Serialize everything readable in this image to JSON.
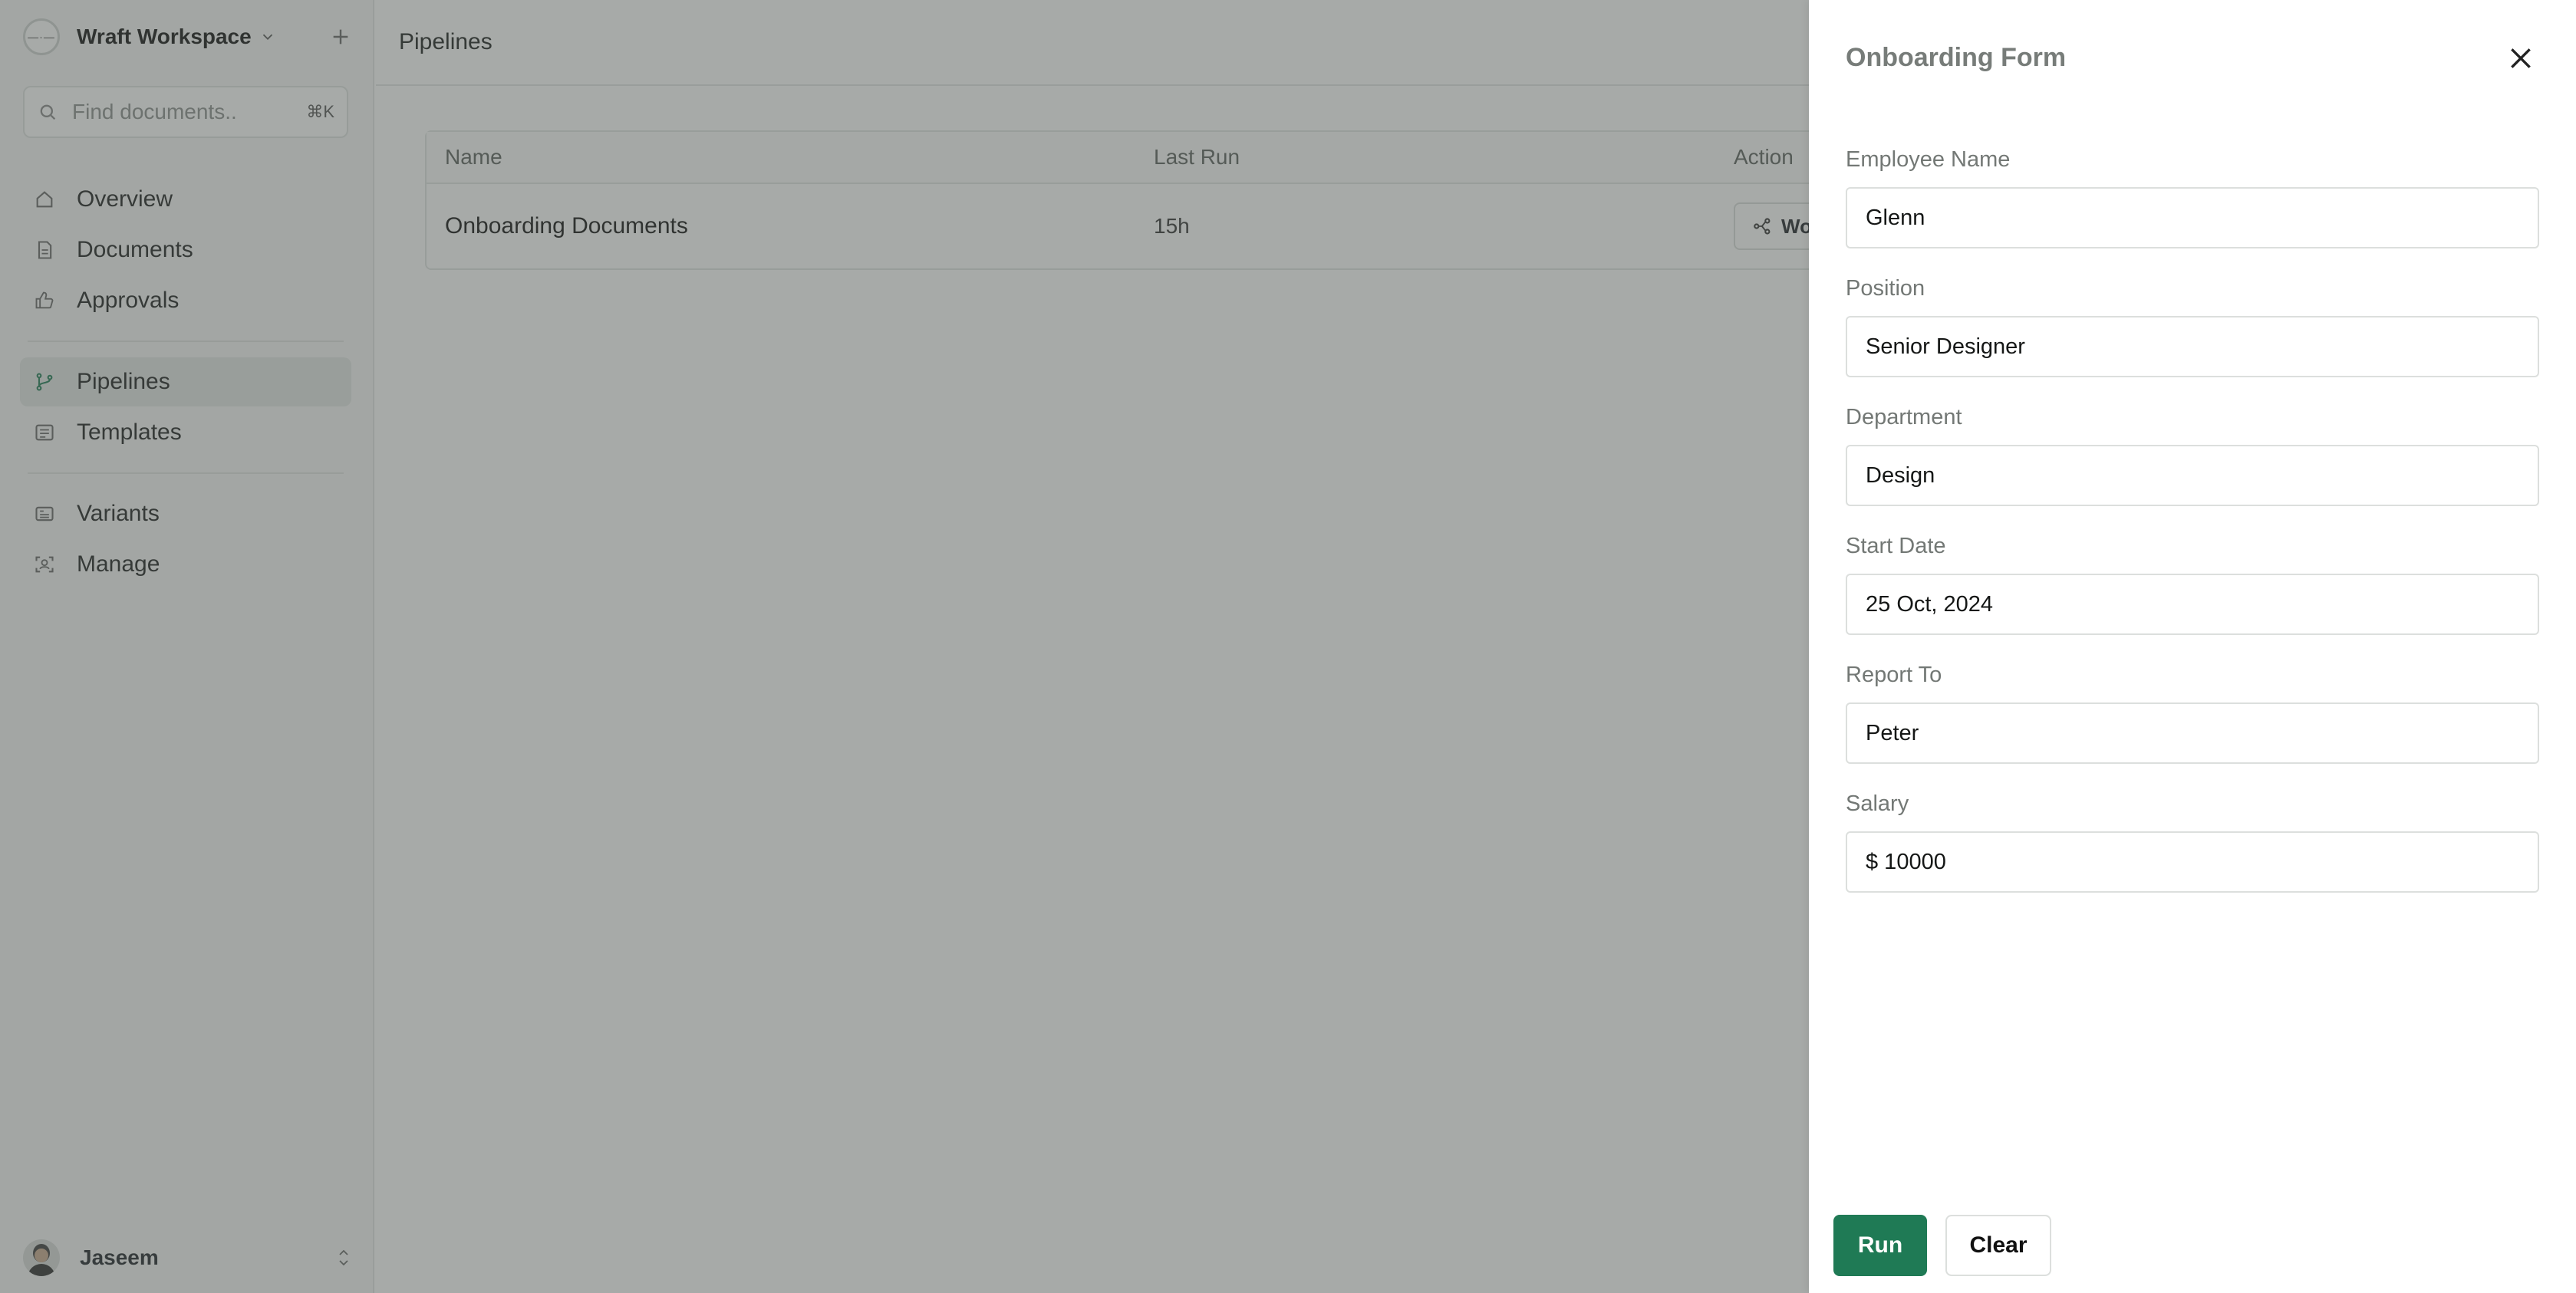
{
  "sidebar": {
    "workspace_logo_text": "—·—",
    "workspace_name": "Wraft Workspace",
    "search_placeholder": "Find documents..",
    "search_shortcut": "⌘K",
    "nav_group1": [
      {
        "label": "Overview",
        "icon": "home-icon"
      },
      {
        "label": "Documents",
        "icon": "document-icon"
      },
      {
        "label": "Approvals",
        "icon": "thumbs-up-icon"
      }
    ],
    "nav_group2": [
      {
        "label": "Pipelines",
        "icon": "git-branch-icon",
        "active": true
      },
      {
        "label": "Templates",
        "icon": "template-icon"
      }
    ],
    "nav_group3": [
      {
        "label": "Variants",
        "icon": "variants-icon"
      },
      {
        "label": "Manage",
        "icon": "manage-icon"
      }
    ],
    "user_name": "Jaseem"
  },
  "main": {
    "page_title": "Pipelines",
    "table": {
      "headers": [
        "Name",
        "Last Run",
        "Action"
      ],
      "rows": [
        {
          "name": "Onboarding Documents",
          "last_run": "15h",
          "action_label": "Wo"
        }
      ]
    }
  },
  "drawer": {
    "title": "Onboarding Form",
    "fields": [
      {
        "label": "Employee Name",
        "value": "Glenn"
      },
      {
        "label": "Position",
        "value": "Senior Designer"
      },
      {
        "label": "Department",
        "value": "Design"
      },
      {
        "label": "Start Date",
        "value": "25 Oct, 2024"
      },
      {
        "label": "Report To",
        "value": "Peter"
      },
      {
        "label": "Salary",
        "value": "$ 10000"
      }
    ],
    "run_label": "Run",
    "clear_label": "Clear"
  },
  "colors": {
    "accent": "#1f7a55",
    "overlay": "rgba(80,85,82,0.5)"
  }
}
